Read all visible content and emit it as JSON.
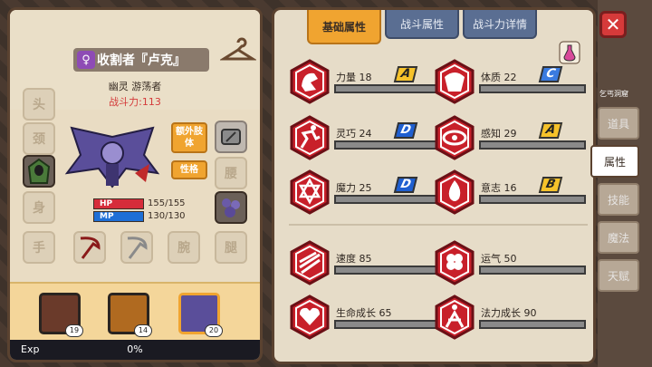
{
  "character": {
    "name": "收割者『卢克』",
    "gender_icon": "female-icon",
    "subtitle": "幽灵 游荡者",
    "power": "战斗力:113",
    "hp_label": "HP",
    "hp_value": "155/155",
    "hp_fraction": 1.0,
    "mp_label": "MP",
    "mp_value": "130/130",
    "mp_fraction": 1.0,
    "extra_button": "额外肢体",
    "trait_button": "性格",
    "slot_labels": [
      "头",
      "颈",
      "身",
      "手",
      "腰",
      "腕",
      "腿",
      "腕",
      "腿"
    ]
  },
  "team": [
    {
      "level": "19"
    },
    {
      "level": "14"
    },
    {
      "level": "20"
    }
  ],
  "exp": {
    "label": "Exp",
    "value": "0%"
  },
  "tabs": [
    "基础属性",
    "战斗属性",
    "战斗力详情"
  ],
  "stats": [
    {
      "label": "力量 18",
      "grade": "A",
      "icon": "strength-icon"
    },
    {
      "label": "体质 22",
      "grade": "C",
      "icon": "constitution-icon"
    },
    {
      "label": "灵巧 24",
      "grade": "D",
      "icon": "agility-icon"
    },
    {
      "label": "感知 29",
      "grade": "A",
      "icon": "perception-eye-icon"
    },
    {
      "label": "魔力 25",
      "grade": "D",
      "icon": "magic-hexagram-icon"
    },
    {
      "label": "意志 16",
      "grade": "B",
      "icon": "will-flame-icon"
    },
    {
      "label": "速度 85",
      "grade": "",
      "icon": "speed-wings-icon"
    },
    {
      "label": "运气 50",
      "grade": "",
      "icon": "luck-clover-icon"
    },
    {
      "label": "生命成长 65",
      "grade": "",
      "icon": "life-growth-icon"
    },
    {
      "label": "法力成长 90",
      "grade": "",
      "icon": "mana-growth-icon"
    }
  ],
  "side_menu": [
    "道具",
    "属性",
    "技能",
    "魔法",
    "天赋"
  ],
  "location": "乞丐洞窟",
  "colors": {
    "accent": "#f0a430",
    "tab": "#5a6e92",
    "hp": "#d62c3a",
    "mp": "#1e6fd6"
  }
}
